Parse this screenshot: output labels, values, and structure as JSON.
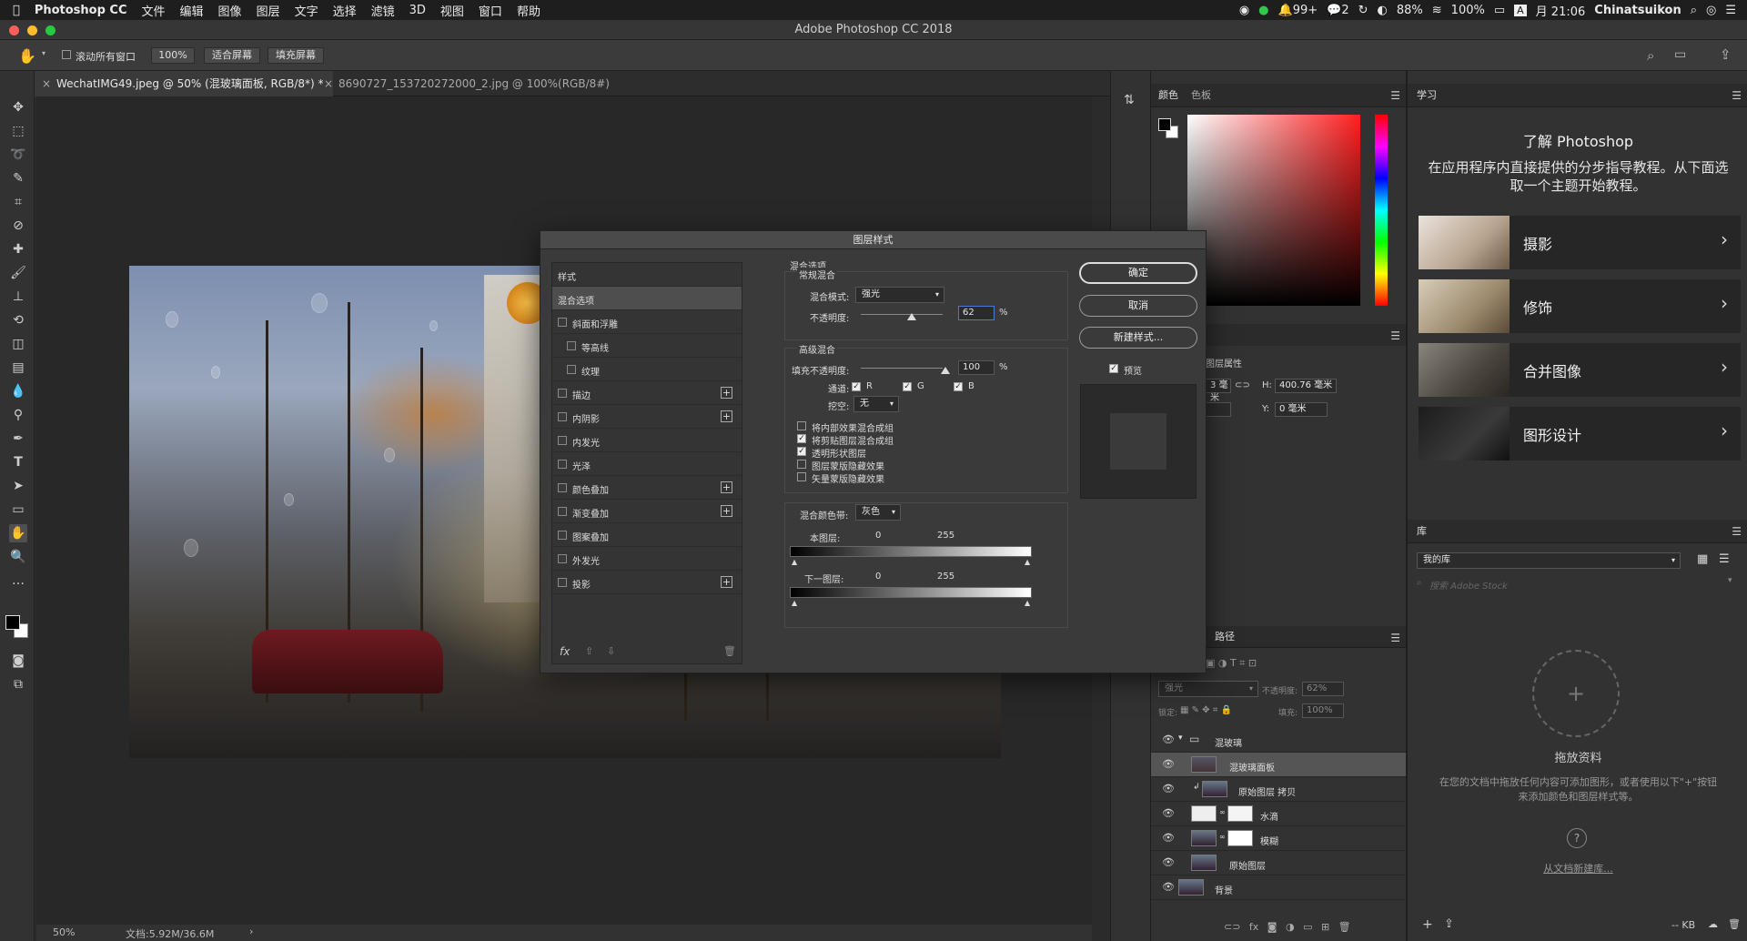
{
  "menubar": {
    "app": "Photoshop CC",
    "items": [
      "文件",
      "编辑",
      "图像",
      "图层",
      "文字",
      "选择",
      "滤镜",
      "3D",
      "视图",
      "窗口",
      "帮助"
    ],
    "status": [
      "99+",
      "2",
      "88%",
      "100%"
    ],
    "time": "月 21:06",
    "user": "Chinatsuikon"
  },
  "window": {
    "title": "Adobe Photoshop CC 2018"
  },
  "options": {
    "scroll_all": "滚动所有窗口",
    "zoom": "100%",
    "fit_screen": "适合屏幕",
    "fill_screen": "填充屏幕"
  },
  "tabs": [
    {
      "label": "WechatIMG49.jpeg @ 50% (混玻璃面板, RGB/8*) *"
    },
    {
      "label": "8690727_153720272000_2.jpg @ 100%(RGB/8#)"
    }
  ],
  "status": {
    "zoom": "50%",
    "doc": "文档:5.92M/36.6M"
  },
  "color_panel": {
    "tab1": "颜色",
    "tab2": "色板"
  },
  "learn_panel": {
    "tab": "学习",
    "title": "了解 Photoshop",
    "desc": "在应用程序内直接提供的分步指导教程。从下面选取一个主题开始教程。",
    "cards": [
      "摄影",
      "修饰",
      "合并图像",
      "图形设计"
    ]
  },
  "properties": {
    "label": "图层属性",
    "w_val": "3 毫米",
    "h_label": "H:",
    "h_val": "400.76 毫米",
    "y_label": "Y:",
    "y_val": "0 毫米"
  },
  "library": {
    "tab": "库",
    "select": "我的库",
    "search_placeholder": "搜索 Adobe Stock",
    "drop_title": "拖放资料",
    "drop_desc": "在您的文档中拖放任何内容可添加图形，或者使用以下\"+\"按钮来添加颜色和图层样式等。",
    "link": "从文档新建库...",
    "size": "-- KB"
  },
  "layers_panel": {
    "tab": "路径",
    "blend": "强光",
    "opacity_label": "不透明度:",
    "opacity": "62%",
    "lock_label": "锁定:",
    "fill_label": "填充:",
    "fill": "100%",
    "layers": [
      {
        "name": "混玻璃"
      },
      {
        "name": "混玻璃面板"
      },
      {
        "name": "原始图层 拷贝"
      },
      {
        "name": "水滴"
      },
      {
        "name": "模糊"
      },
      {
        "name": "原始图层"
      },
      {
        "name": "背景"
      }
    ]
  },
  "dialog": {
    "title": "图层样式",
    "styles_header": "样式",
    "styles": [
      {
        "label": "混合选项",
        "checkbox": false,
        "plus": false,
        "indent": false
      },
      {
        "label": "斜面和浮雕",
        "checkbox": true,
        "plus": false,
        "indent": false
      },
      {
        "label": "等高线",
        "checkbox": true,
        "plus": false,
        "indent": true
      },
      {
        "label": "纹理",
        "checkbox": true,
        "plus": false,
        "indent": true
      },
      {
        "label": "描边",
        "checkbox": true,
        "plus": true,
        "indent": false
      },
      {
        "label": "内阴影",
        "checkbox": true,
        "plus": true,
        "indent": false
      },
      {
        "label": "内发光",
        "checkbox": true,
        "plus": false,
        "indent": false
      },
      {
        "label": "光泽",
        "checkbox": true,
        "plus": false,
        "indent": false
      },
      {
        "label": "颜色叠加",
        "checkbox": true,
        "plus": true,
        "indent": false
      },
      {
        "label": "渐变叠加",
        "checkbox": true,
        "plus": true,
        "indent": false
      },
      {
        "label": "图案叠加",
        "checkbox": true,
        "plus": false,
        "indent": false
      },
      {
        "label": "外发光",
        "checkbox": true,
        "plus": false,
        "indent": false
      },
      {
        "label": "投影",
        "checkbox": true,
        "plus": true,
        "indent": false
      }
    ],
    "blend_options": "混合选项",
    "general_blending": "常规混合",
    "blend_mode_label": "混合模式:",
    "blend_mode": "强光",
    "opacity_label": "不透明度:",
    "opacity": "62",
    "pct": "%",
    "advanced_blending": "高级混合",
    "fill_opacity_label": "填充不透明度:",
    "fill_opacity": "100",
    "channels_label": "通道:",
    "ch_r": "R",
    "ch_g": "G",
    "ch_b": "B",
    "knockout_label": "挖空:",
    "knockout": "无",
    "adv_options": [
      {
        "label": "将内部效果混合成组",
        "checked": false
      },
      {
        "label": "将剪贴图层混合成组",
        "checked": true
      },
      {
        "label": "透明形状图层",
        "checked": true
      },
      {
        "label": "图层蒙版隐藏效果",
        "checked": false
      },
      {
        "label": "矢量蒙版隐藏效果",
        "checked": false
      }
    ],
    "blend_if_label": "混合颜色带:",
    "blend_if": "灰色",
    "this_layer": "本图层:",
    "underlying": "下一图层:",
    "lo": "0",
    "hi": "255",
    "ok": "确定",
    "cancel": "取消",
    "new_style": "新建样式...",
    "preview": "预览"
  }
}
